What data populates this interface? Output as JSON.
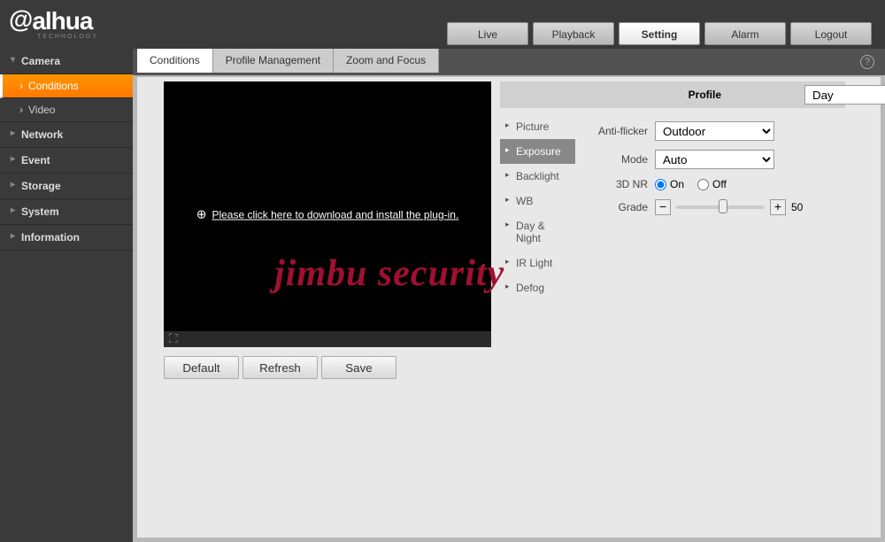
{
  "logo": {
    "text": "alhua",
    "sub": "TECHNOLOGY"
  },
  "topNav": {
    "live": "Live",
    "playback": "Playback",
    "setting": "Setting",
    "alarm": "Alarm",
    "logout": "Logout"
  },
  "tabs": {
    "conditions": "Conditions",
    "profileMgmt": "Profile Management",
    "zoomFocus": "Zoom and Focus"
  },
  "sidebar": {
    "camera": "Camera",
    "conditions": "Conditions",
    "video": "Video",
    "network": "Network",
    "event": "Event",
    "storage": "Storage",
    "system": "System",
    "information": "Information"
  },
  "plugin_message": "Please click here to download and install the plug-in.",
  "buttons": {
    "default": "Default",
    "refresh": "Refresh",
    "save": "Save"
  },
  "profile": {
    "label": "Profile",
    "value": "Day"
  },
  "categories": {
    "picture": "Picture",
    "exposure": "Exposure",
    "backlight": "Backlight",
    "wb": "WB",
    "daynight": "Day & Night",
    "irlight": "IR Light",
    "defog": "Defog"
  },
  "form": {
    "antiFlicker": {
      "label": "Anti-flicker",
      "value": "Outdoor"
    },
    "mode": {
      "label": "Mode",
      "value": "Auto"
    },
    "nr3d": {
      "label": "3D NR",
      "on": "On",
      "off": "Off"
    },
    "grade": {
      "label": "Grade",
      "value": "50"
    }
  },
  "watermark": "jimbu security"
}
